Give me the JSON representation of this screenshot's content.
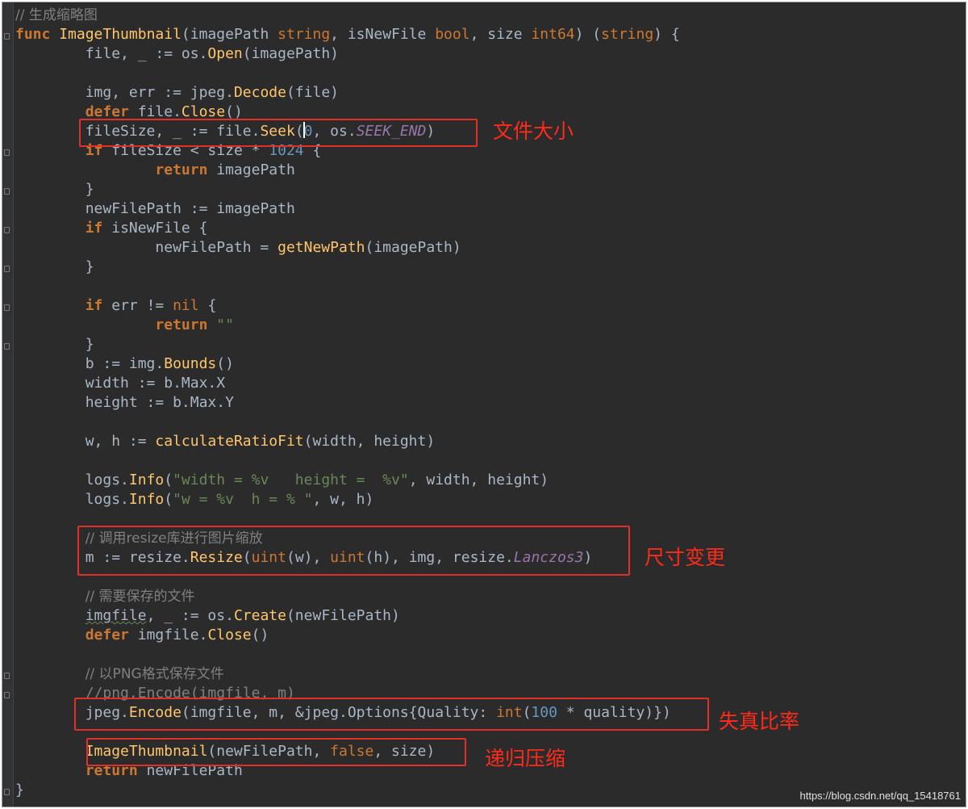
{
  "code": {
    "comment_title": "// 生成缩略图",
    "sig": {
      "kw_func": "func",
      "name": "ImageThumbnail",
      "p1": "(imagePath ",
      "t1": "string",
      "p2": ", isNewFile ",
      "t2": "bool",
      "p3": ", size ",
      "t3": "int64",
      "p4": ") (",
      "t4": "string",
      "p5": ") {"
    },
    "l3": {
      "a": "file, _ := os.",
      "f": "Open",
      "b": "(imagePath)"
    },
    "l5": {
      "a": "img, err := jpeg.",
      "f": "Decode",
      "b": "(file)"
    },
    "l6": {
      "kw": "defer",
      "a": " file.",
      "f": "Close",
      "b": "()"
    },
    "l7": {
      "a": "fileSize, _ := file.",
      "f": "Seek",
      "b": "(",
      "n": "0",
      "c": ", os.",
      "k": "SEEK_END",
      "d": ")"
    },
    "l8": {
      "kw": "if",
      "a": " fileSize < size * ",
      "n": "1024",
      "b": " {"
    },
    "l9": {
      "kw": "return",
      "a": " imagePath"
    },
    "l10": "}",
    "l11": "newFilePath := imagePath",
    "l12": {
      "kw": "if",
      "a": " isNewFile {"
    },
    "l13": {
      "a": "newFilePath = ",
      "f": "getNewPath",
      "b": "(imagePath)"
    },
    "l14": "}",
    "l16": {
      "kw": "if",
      "a": " err != ",
      "k": "nil",
      "b": " {"
    },
    "l17": {
      "kw": "return",
      "s": " \"\""
    },
    "l18": "}",
    "l19": {
      "a": "b := img.",
      "f": "Bounds",
      "b": "()"
    },
    "l20": "width := b.Max.X",
    "l21": "height := b.Max.Y",
    "l23": {
      "a": "w, h := ",
      "f": "calculateRatioFit",
      "b": "(width, height)"
    },
    "l25": {
      "a": "logs.",
      "f": "Info",
      "b": "(",
      "s": "\"width = %v   height =  %v\"",
      "c": ", width, height)"
    },
    "l26": {
      "a": "logs.",
      "f": "Info",
      "b": "(",
      "s": "\"w = %v  h = % \"",
      "c": ", w, h)"
    },
    "l28": "// 调用resize库进行图片缩放",
    "l29": {
      "a": "m := resize.",
      "f": "Resize",
      "b": "(",
      "t1": "uint",
      "c": "(w), ",
      "t2": "uint",
      "d": "(h), img, resize.",
      "k": "Lanczos3",
      "e": ")"
    },
    "l31": "// 需要保存的文件",
    "l32": {
      "u": "imgfile",
      "a": ", _ := os.",
      "f": "Create",
      "b": "(newFilePath)"
    },
    "l33": {
      "kw": "defer",
      "a": " imgfile.",
      "f": "Close",
      "b": "()"
    },
    "l35": "// 以PNG格式保存文件",
    "l36": "//png.Encode(imgfile, m)",
    "l37": {
      "a": "jpeg.",
      "f": "Encode",
      "b": "(imgfile, m, &jpeg.Options{Quality: ",
      "t": "int",
      "c": "(",
      "n": "100",
      "d": " * quality)})"
    },
    "l39": {
      "f": "ImageThumbnail",
      "a": "(newFilePath, ",
      "k": "false",
      "b": ", size)"
    },
    "l40": {
      "kw": "return",
      "a": " newFilePath"
    },
    "l41": "}"
  },
  "annotations": {
    "file_size": "文件大小",
    "resize": "尺寸变更",
    "distortion": "失真比率",
    "recursive": "递归压缩"
  },
  "watermark": "https://blog.csdn.net/qq_15418761"
}
